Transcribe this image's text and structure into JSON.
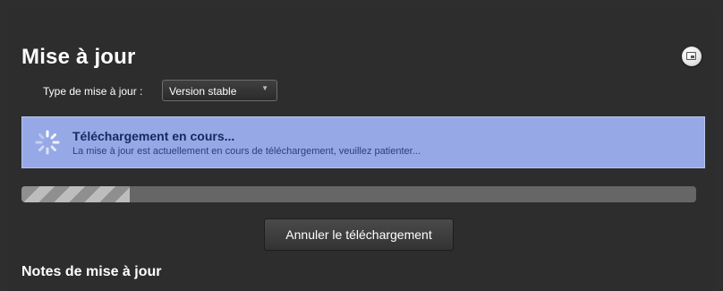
{
  "page": {
    "title": "Mise à jour",
    "notes_title": "Notes de mise à jour"
  },
  "update_type": {
    "label": "Type de mise à jour :",
    "selected": "Version stable"
  },
  "status": {
    "title": "Téléchargement en cours...",
    "description": "La mise à jour est actuellement en cours de téléchargement, veuillez patienter...",
    "background_color": "#96a8e6"
  },
  "progress": {
    "fraction": 0.16
  },
  "actions": {
    "cancel_label": "Annuler le téléchargement"
  },
  "icons": {
    "corner": "window-restore-icon",
    "status": "loading-spinner-icon",
    "select": "chevron-down-icon"
  }
}
